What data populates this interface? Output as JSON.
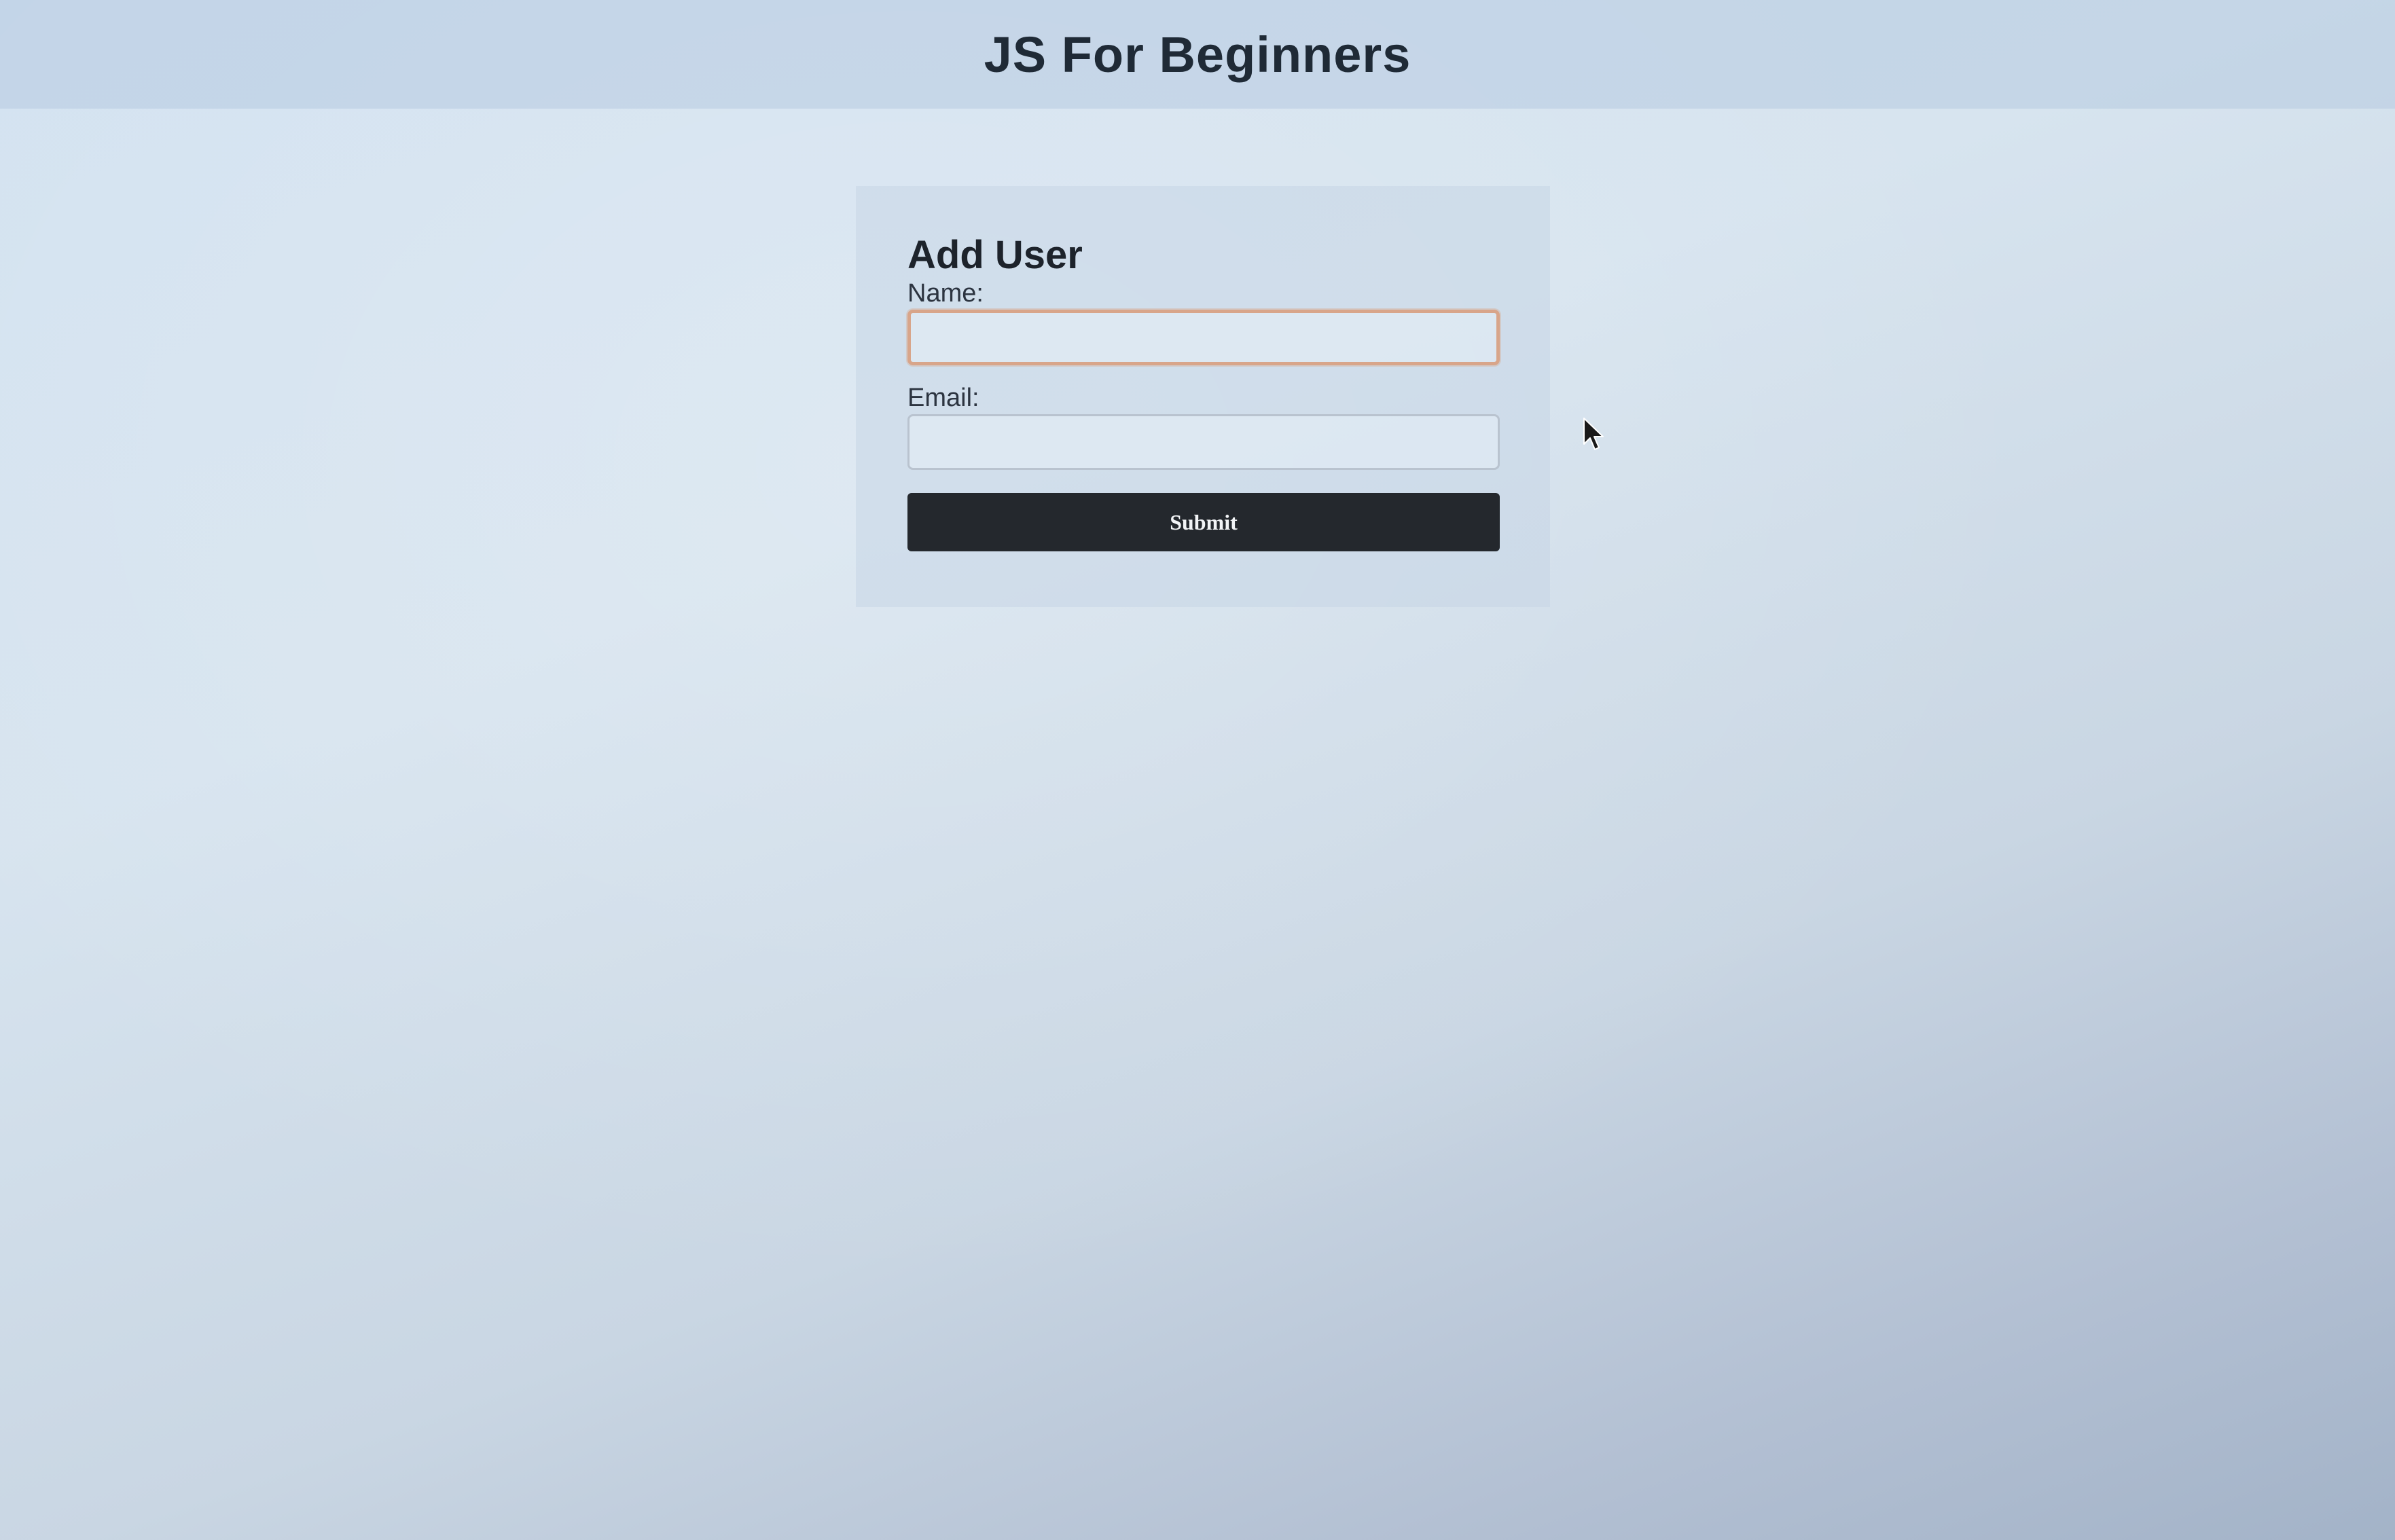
{
  "header": {
    "title": "JS For Beginners"
  },
  "form": {
    "heading": "Add User",
    "name_label": "Name:",
    "name_value": "",
    "email_label": "Email:",
    "email_value": "",
    "submit_label": "Submit"
  },
  "icons": {
    "cursor": "mouse-pointer-icon"
  },
  "colors": {
    "focus_border": "#d8a58a",
    "button_bg": "#24282d",
    "button_text": "#f2f4f6"
  }
}
